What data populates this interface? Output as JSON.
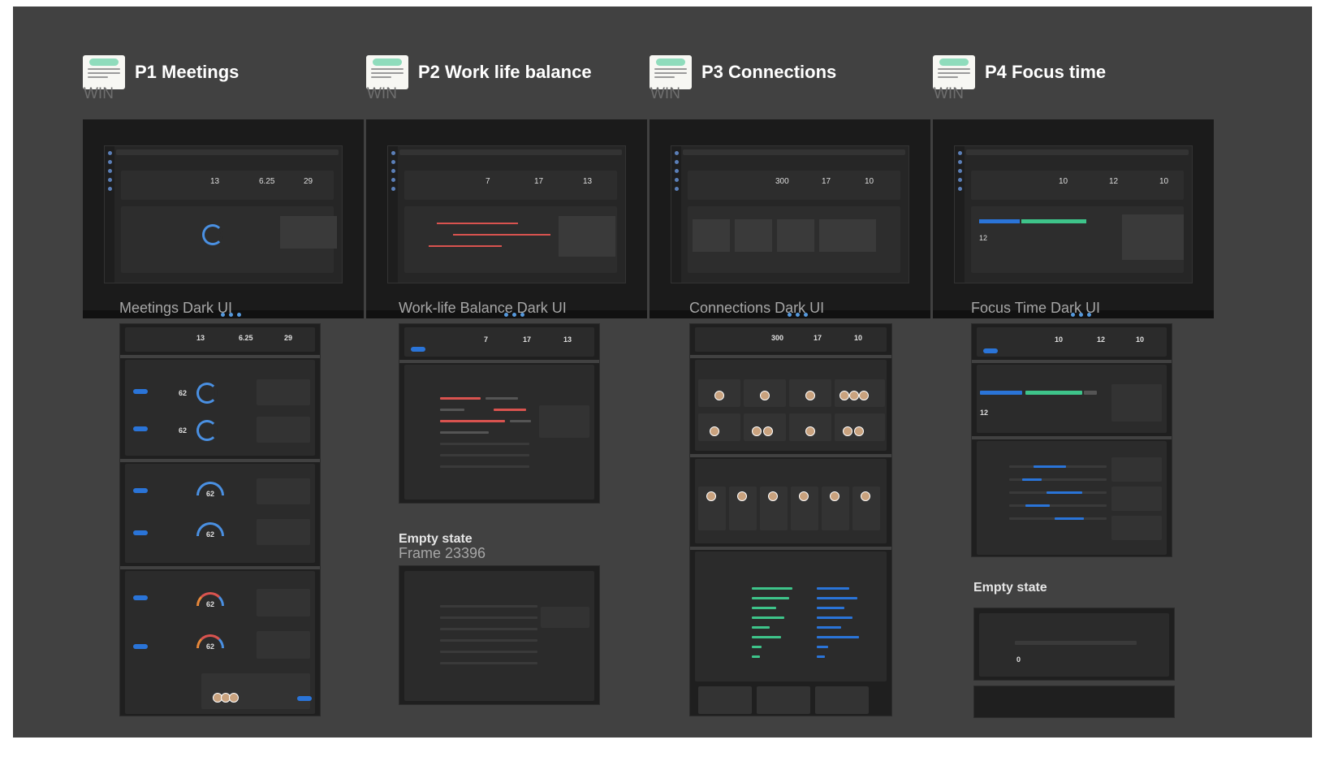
{
  "sections": [
    {
      "title": "P1 Meetings",
      "platform": "WIN",
      "frame_label": "Meetings Dark UI",
      "kpis": [
        "13",
        "6.25",
        "29"
      ],
      "gauge_value": "62"
    },
    {
      "title": "P2 Work life balance",
      "platform": "WIN",
      "frame_label": "Work-life Balance Dark UI",
      "kpis": [
        "7",
        "17",
        "13"
      ],
      "empty_title": "Empty state",
      "empty_subtitle": "Frame 23396"
    },
    {
      "title": "P3 Connections",
      "platform": "WIN",
      "frame_label": "Connections Dark UI",
      "kpis": [
        "300",
        "17",
        "10"
      ]
    },
    {
      "title": "P4 Focus time",
      "platform": "WIN",
      "frame_label": "Focus Time Dark UI",
      "kpis": [
        "10",
        "12",
        "10"
      ],
      "focus_value": "12",
      "empty_title": "Empty state",
      "empty_value": "0"
    }
  ],
  "colors": {
    "canvas": "#414141",
    "frame": "#1f1f1f",
    "accent_blue": "#4a90e2",
    "accent_green": "#3ec48a",
    "accent_red": "#d9534f",
    "sticky_tag": "#8fdcbc"
  }
}
